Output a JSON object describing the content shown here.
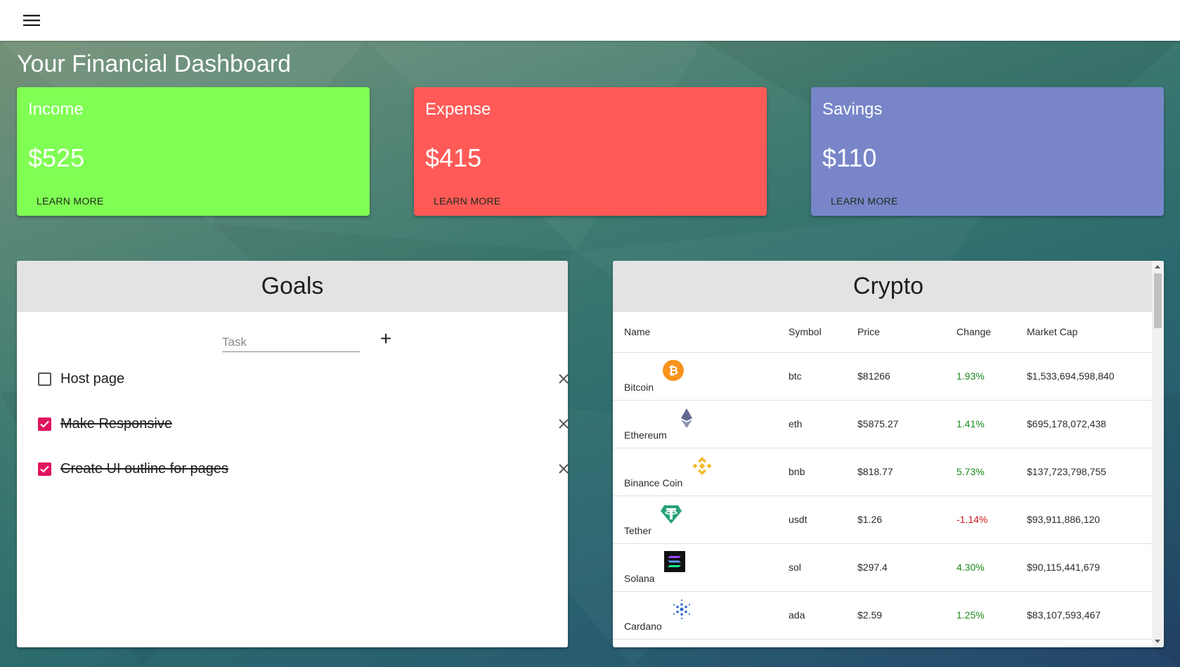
{
  "page": {
    "title": "Your Financial Dashboard"
  },
  "stats": [
    {
      "label": "Income",
      "amount": "$525",
      "action": "LEARN MORE",
      "color": "#80ff54"
    },
    {
      "label": "Expense",
      "amount": "$415",
      "action": "LEARN MORE",
      "color": "#ff5a57"
    },
    {
      "label": "Savings",
      "amount": "$110",
      "action": "LEARN MORE",
      "color": "#7886c9"
    }
  ],
  "goals": {
    "title": "Goals",
    "task_placeholder": "Task",
    "add_label": "+",
    "items": [
      {
        "text": "Host page",
        "done": false
      },
      {
        "text": "Make Responsive",
        "done": true
      },
      {
        "text": "Create UI outline for pages",
        "done": true
      }
    ]
  },
  "crypto": {
    "title": "Crypto",
    "columns": [
      "Name",
      "Symbol",
      "Price",
      "Change",
      "Market Cap"
    ],
    "rows": [
      {
        "name": "Bitcoin",
        "symbol": "btc",
        "price": "$81266",
        "change": "1.93%",
        "market_cap": "$1,533,694,598,840",
        "icon": "bitcoin-icon"
      },
      {
        "name": "Ethereum",
        "symbol": "eth",
        "price": "$5875.27",
        "change": "1.41%",
        "market_cap": "$695,178,072,438",
        "icon": "ethereum-icon"
      },
      {
        "name": "Binance Coin",
        "symbol": "bnb",
        "price": "$818.77",
        "change": "5.73%",
        "market_cap": "$137,723,798,755",
        "icon": "binance-icon"
      },
      {
        "name": "Tether",
        "symbol": "usdt",
        "price": "$1.26",
        "change": "-1.14%",
        "market_cap": "$93,911,886,120",
        "icon": "tether-icon"
      },
      {
        "name": "Solana",
        "symbol": "sol",
        "price": "$297.4",
        "change": "4.30%",
        "market_cap": "$90,115,441,679",
        "icon": "solana-icon"
      },
      {
        "name": "Cardano",
        "symbol": "ada",
        "price": "$2.59",
        "change": "1.25%",
        "market_cap": "$83,107,593,467",
        "icon": "cardano-icon"
      }
    ]
  },
  "colors": {
    "checked": "#e0135f",
    "positive": "#1c8a1c",
    "negative": "#d01818"
  }
}
